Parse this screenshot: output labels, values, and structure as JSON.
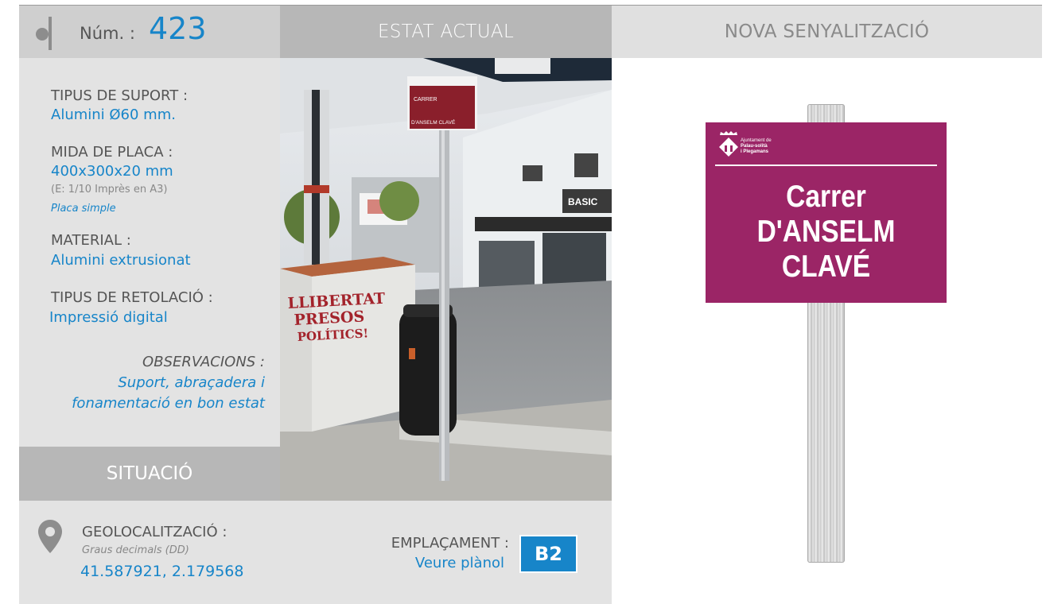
{
  "header": {
    "num_label": "Núm. :",
    "num_value": "423",
    "estat_actual": "ESTAT ACTUAL",
    "nova_senyalitzacio": "NOVA SENYALITZACIÓ"
  },
  "specs": {
    "suport_label": "TIPUS DE SUPORT :",
    "suport_value": "Alumini Ø60 mm.",
    "mida_label": "MIDA DE PLACA :",
    "mida_value": "400x300x20 mm",
    "mida_scale": "(E: 1/10 Imprès en A3)",
    "mida_type": "Placa simple",
    "material_label": "MATERIAL :",
    "material_value": "Alumini extrusionat",
    "retolacio_label": "TIPUS DE RETOLACIÓ :",
    "retolacio_value": "Impressió digital",
    "observacions_label": "OBSERVACIONS :",
    "observacions_line1": "Suport, abraçadera i",
    "observacions_line2": "fonamentació en bon estat"
  },
  "situacio": {
    "title": "SITUACIÓ",
    "geo_label": "GEOLOCALITZACIÓ :",
    "geo_format": "Graus decimals (DD)",
    "geo_value": "41.587921, 2.179568",
    "emplacament_label": "EMPLAÇAMENT :",
    "emplacament_link": "Veure plànol",
    "emplacament_code": "B2"
  },
  "photo": {
    "sign_line1": "CARRER",
    "sign_line2": "D'ANSELM CLAVÉ",
    "graffiti_line1": "LLIBERTAT",
    "graffiti_line2": "PRESOS",
    "graffiti_line3": "POLÍTICS!",
    "store_text": "BASIC"
  },
  "new_sign": {
    "org_line1": "Ajuntament de",
    "org_line2": "Palau-solità",
    "org_line3": "i Plegamans",
    "line1": "Carrer",
    "line2": "D'ANSELM",
    "line3": "CLAVÉ",
    "color": "#9b2566"
  },
  "colors": {
    "accent": "#1785c9",
    "header_grey": "#b7b7b7",
    "panel_grey": "#e3e3e3"
  }
}
